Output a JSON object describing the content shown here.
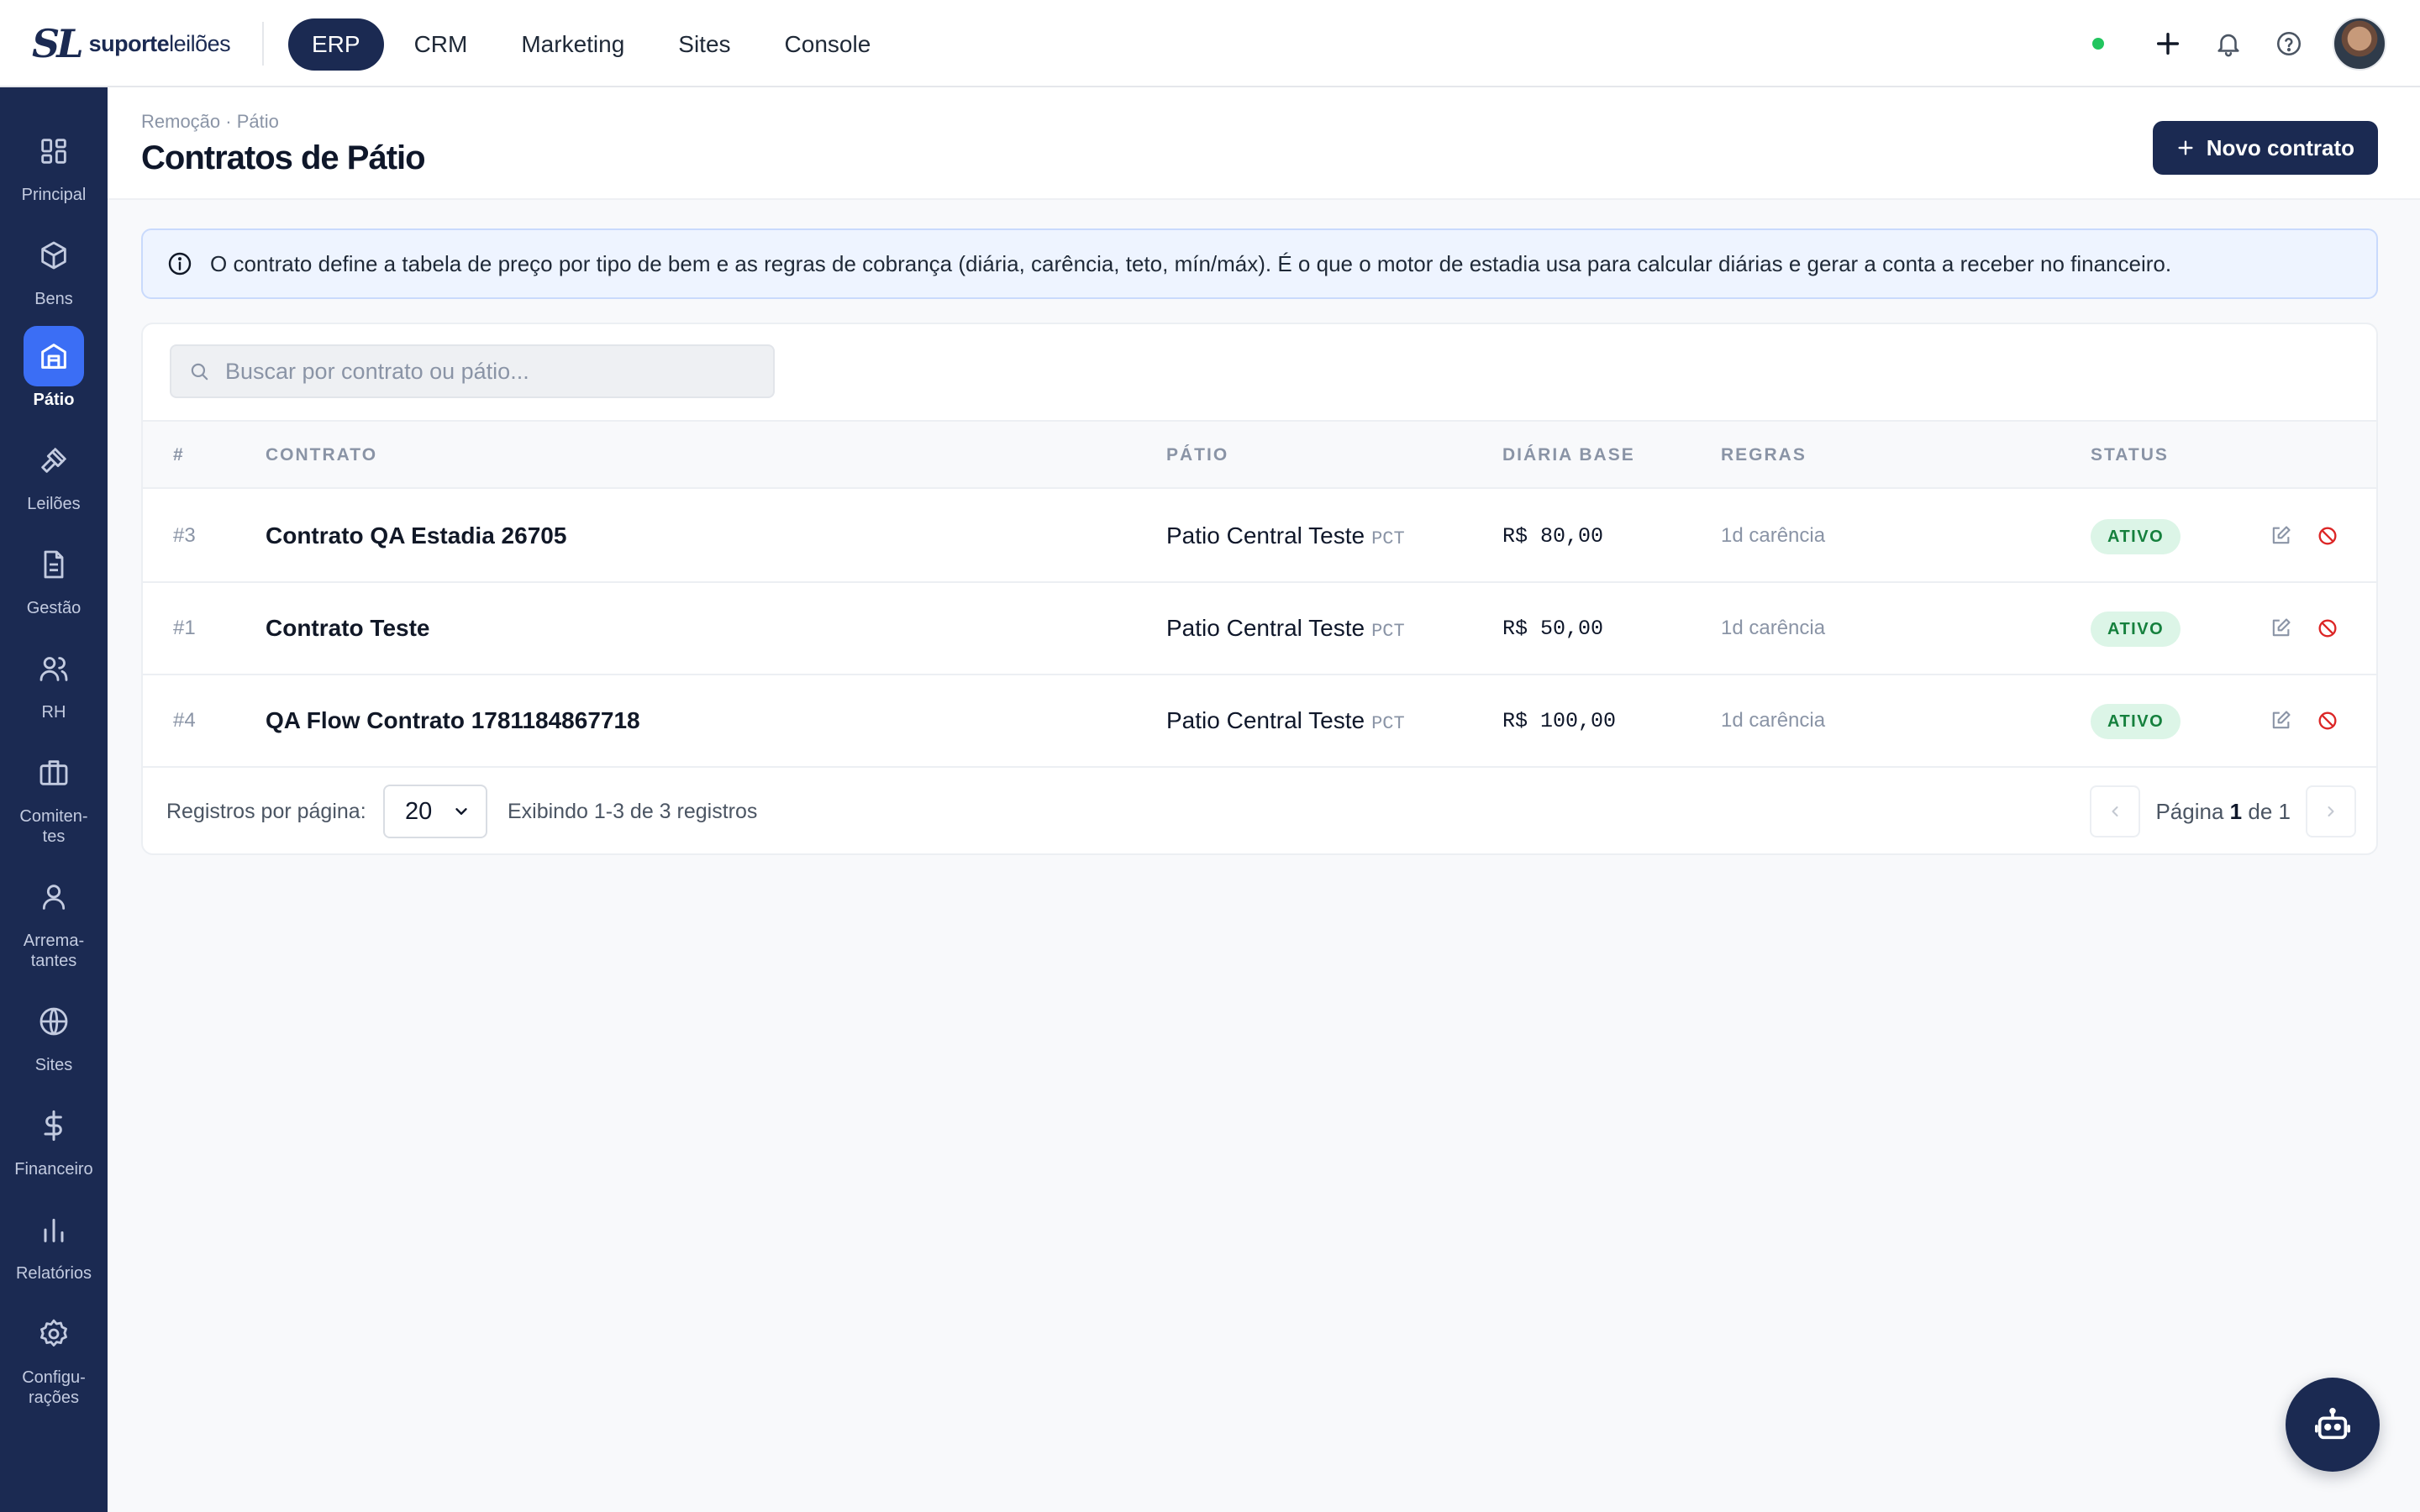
{
  "app": {
    "logo_mark": "SL",
    "logo_text_bold": "suporte",
    "logo_text_light": "leilões"
  },
  "topnav": {
    "items": [
      {
        "label": "ERP",
        "active": true
      },
      {
        "label": "CRM"
      },
      {
        "label": "Marketing"
      },
      {
        "label": "Sites"
      },
      {
        "label": "Console"
      }
    ]
  },
  "sidebar": {
    "items": [
      {
        "label": "Principal",
        "icon": "dashboard-icon"
      },
      {
        "label": "Bens",
        "icon": "box-icon"
      },
      {
        "label": "Pátio",
        "icon": "warehouse-icon",
        "active": true
      },
      {
        "label": "Leilões",
        "icon": "gavel-icon"
      },
      {
        "label": "Gestão",
        "icon": "document-icon"
      },
      {
        "label": "RH",
        "icon": "users-icon"
      },
      {
        "label": "Comiten-tes",
        "icon": "briefcase-icon"
      },
      {
        "label": "Arrema-tantes",
        "icon": "user-icon"
      },
      {
        "label": "Sites",
        "icon": "globe-icon"
      },
      {
        "label": "Financeiro",
        "icon": "dollar-icon"
      },
      {
        "label": "Relatórios",
        "icon": "bar-chart-icon"
      },
      {
        "label": "Configu-rações",
        "icon": "gear-icon"
      }
    ]
  },
  "header": {
    "breadcrumb": "Remoção · Pátio",
    "title": "Contratos de Pátio",
    "new_button": "Novo contrato"
  },
  "info": {
    "text": "O contrato define a tabela de preço por tipo de bem e as regras de cobrança (diária, carência, teto, mín/máx). É o que o motor de estadia usa para calcular diárias e gerar a conta a receber no financeiro."
  },
  "search": {
    "placeholder": "Buscar por contrato ou pátio..."
  },
  "table": {
    "columns": [
      "#",
      "CONTRATO",
      "PÁTIO",
      "DIÁRIA BASE",
      "REGRAS",
      "STATUS"
    ],
    "rows": [
      {
        "id": "#3",
        "contract": "Contrato QA Estadia 26705",
        "patio": "Patio Central Teste",
        "patio_code": "PCT",
        "daily": "R$ 80,00",
        "rules": "1d carência",
        "status": "ATIVO"
      },
      {
        "id": "#1",
        "contract": "Contrato Teste",
        "patio": "Patio Central Teste",
        "patio_code": "PCT",
        "daily": "R$ 50,00",
        "rules": "1d carência",
        "status": "ATIVO"
      },
      {
        "id": "#4",
        "contract": "QA Flow Contrato 1781184867718",
        "patio": "Patio Central Teste",
        "patio_code": "PCT",
        "daily": "R$ 100,00",
        "rules": "1d carência",
        "status": "ATIVO"
      }
    ]
  },
  "footer": {
    "per_page_label": "Registros por página:",
    "per_page_value": "20",
    "info": "Exibindo 1-3 de 3 registros",
    "page_label": "Página",
    "page_current": "1",
    "page_of": "de",
    "page_total": "1"
  },
  "colors": {
    "navy": "#1b2a52",
    "accent": "#3b6ef5",
    "success_bg": "#dcf5e7",
    "success_text": "#15803d",
    "danger": "#dc2626",
    "online": "#22c55e"
  }
}
